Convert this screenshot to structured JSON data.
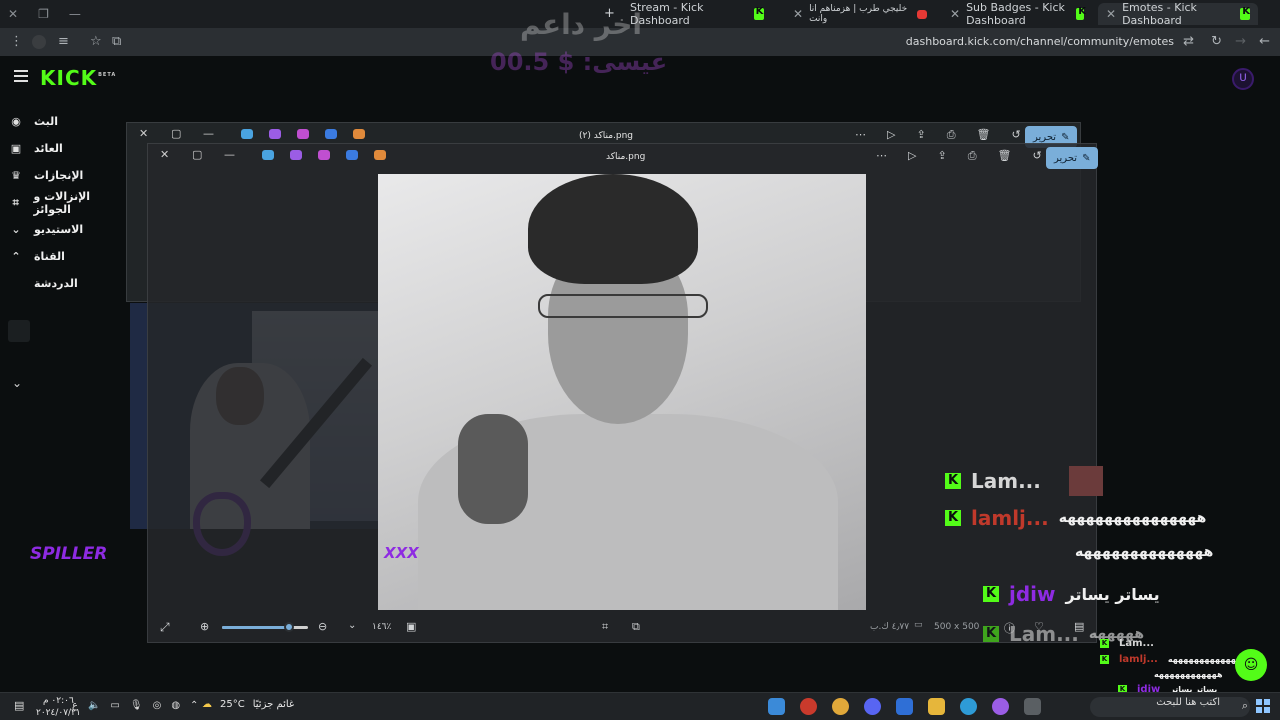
{
  "browser": {
    "tabs": [
      {
        "title": "Stream - Kick Dashboard",
        "favicon": "kick-icon"
      },
      {
        "title": "خليجي طرب | هزمناهم انا وانت",
        "favicon": "youtube-icon"
      },
      {
        "title": "Sub Badges - Kick Dashboard",
        "favicon": "kick-icon"
      },
      {
        "title": "Emotes - Kick Dashboard",
        "favicon": "kick-icon",
        "active": true
      }
    ],
    "new_tab": "+",
    "url": "dashboard.kick.com/channel/community/emotes"
  },
  "kick": {
    "logo": "KICK",
    "logo_badge": "BETA",
    "avatar": "ᑌ",
    "sidebar": [
      {
        "label": "البث",
        "icon": "broadcast-icon"
      },
      {
        "label": "العائد",
        "icon": "revenue-icon"
      },
      {
        "label": "الإنجازات",
        "icon": "trophy-icon"
      },
      {
        "label": "الإنزالات و الجوائز",
        "icon": "drops-icon"
      },
      {
        "label": "الاستيديو",
        "icon": "chevron-down-icon"
      },
      {
        "label": "القناة",
        "icon": "chevron-up-icon"
      },
      {
        "label": "الدردشة",
        "icon": ""
      }
    ]
  },
  "overlay": {
    "last_supporter_title": "اخر داعم",
    "last_supporter_value": "عيسى: $ 00.5",
    "spiller": "SPILLER",
    "xxx": "XXX"
  },
  "viewer_back": {
    "title": "مناكد (٢).png",
    "edit": "تحرير"
  },
  "viewer_front": {
    "title": "مناكد.png",
    "edit": "تحرير",
    "zoom_fraction": 0.78,
    "zoom_label": "١٤٦٪",
    "dimensions": "500 x 500",
    "file_size": "٤٫٧٧ ك.ب"
  },
  "chat_big": [
    {
      "name": "Lam...",
      "message": "",
      "color": "#d6d6d6"
    },
    {
      "name": "lamlj...",
      "message": "هههههههههههههههه",
      "color": "#c0392b"
    },
    {
      "name": "",
      "message": "ههههههههههههههه",
      "color": "#d6d6d6"
    },
    {
      "name": "jdiw",
      "message": "يساتر يساتر",
      "color": "#8e2be2"
    },
    {
      "name": "Lam...",
      "message": "هههههه",
      "color": "#d6d6d6"
    }
  ],
  "chat_small": [
    {
      "name": "Lam...",
      "message": "",
      "color": "#d6d6d6"
    },
    {
      "name": "lamlj...",
      "message": "ههههههههههههههه",
      "color": "#c0392b"
    },
    {
      "name": "",
      "message": "ههههههههههههه",
      "color": "#d6d6d6"
    },
    {
      "name": "jdiw",
      "message": "يساتر يساتر",
      "color": "#8e2be2"
    },
    {
      "name": "Lam...",
      "message": "",
      "color": "#d6d6d6"
    }
  ],
  "taskbar": {
    "time": "٠٢:٠٦ م",
    "date": "٢٠٢٤/٠٧/٢١",
    "weather_temp": "25°C",
    "weather_text": "غائم جزئيًا",
    "search": "اكتب هنا للبحث",
    "lang": "ع"
  },
  "colors": {
    "kick_green": "#53fc18",
    "purple": "#8e2be2",
    "edit_blue": "#7aaed9"
  }
}
